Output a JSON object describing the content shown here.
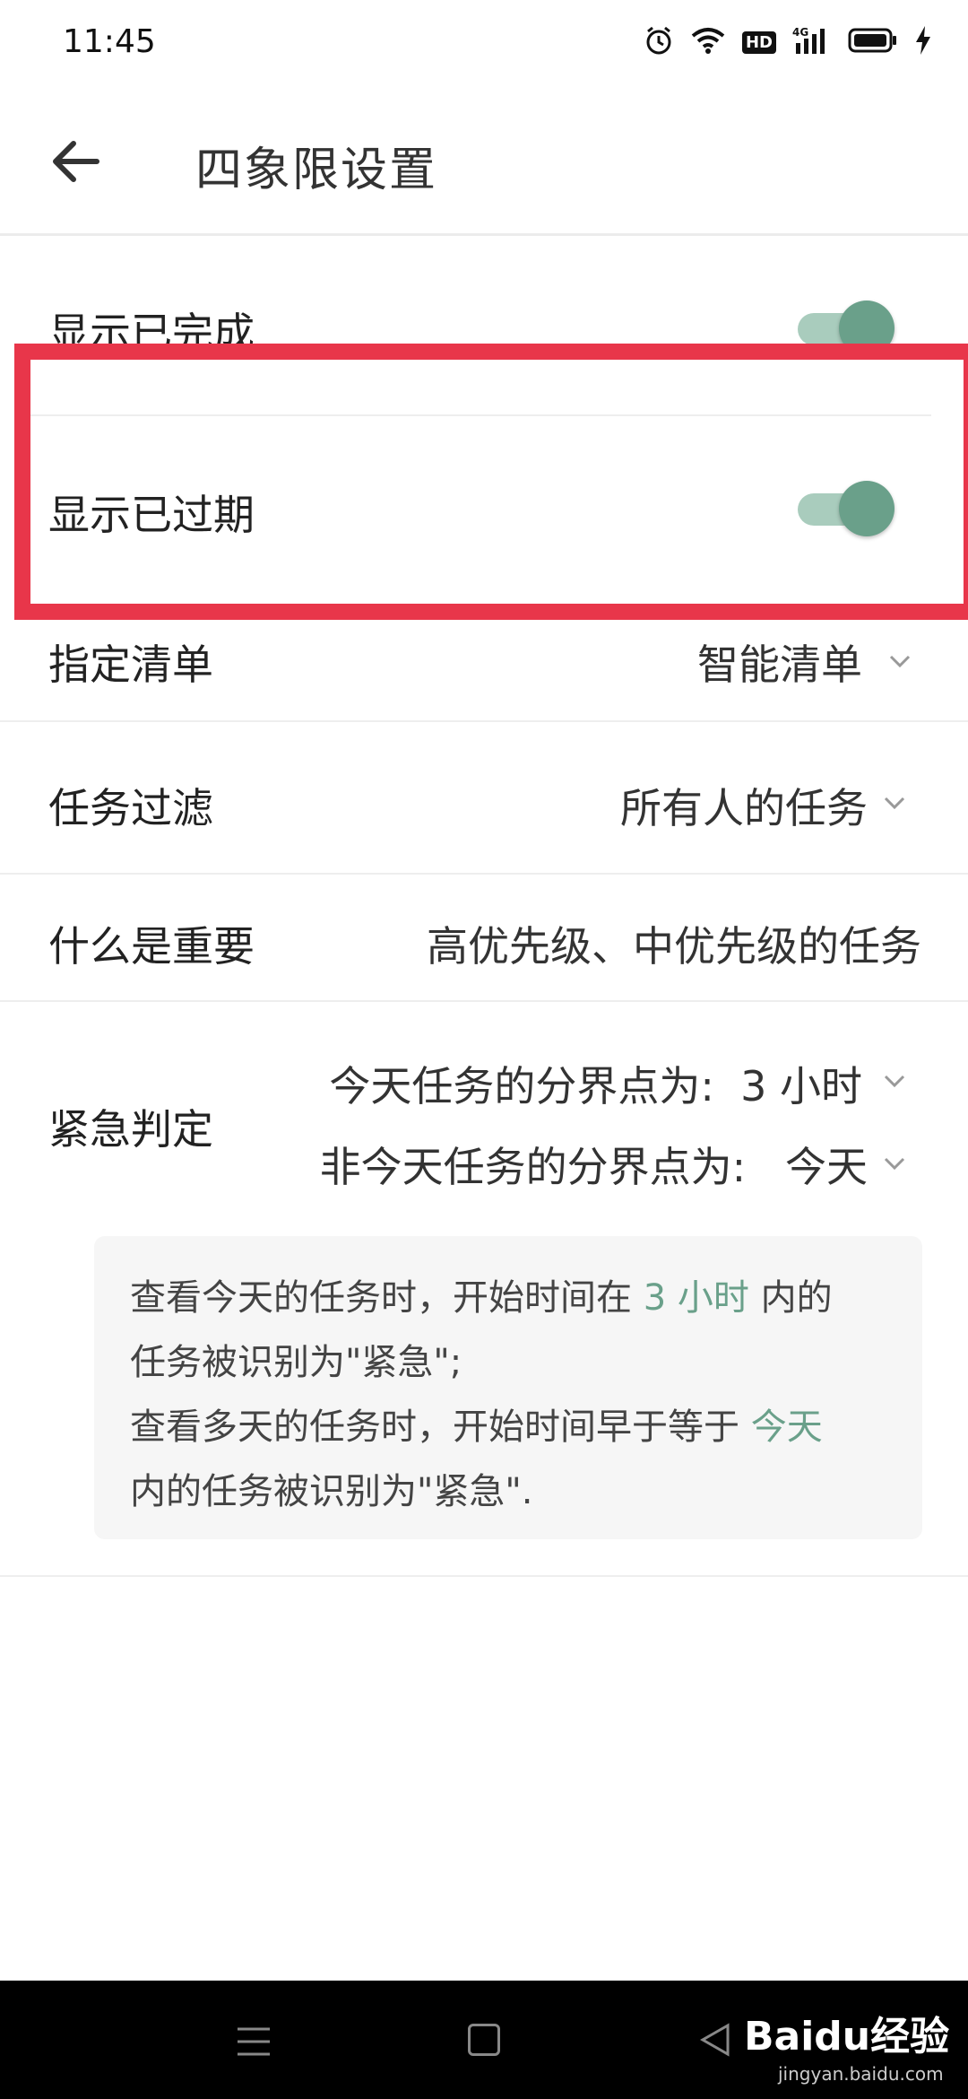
{
  "status_bar": {
    "time": "11:45",
    "icons": [
      "alarm-icon",
      "wifi-icon",
      "hd-icon",
      "signal-4g-icon",
      "battery-icon",
      "charging-icon"
    ],
    "hd_label": "HD",
    "net_label": "4G"
  },
  "app_bar": {
    "title": "四象限设置",
    "back_icon": "arrow-left-icon"
  },
  "settings": {
    "show_completed": {
      "label": "显示已完成",
      "enabled": true
    },
    "show_overdue": {
      "label": "显示已过期",
      "enabled": true
    },
    "assigned_list": {
      "label": "指定清单",
      "value": "智能清单"
    },
    "task_filter": {
      "label": "任务过滤",
      "value": "所有人的任务"
    },
    "what_is_important": {
      "label": "什么是重要",
      "value": "高优先级、中优先级的任务"
    },
    "urgency": {
      "label": "紧急判定",
      "today_cutoff": "今天任务的分界点为:  3 小时",
      "non_today_cutoff": "非今天任务的分界点为:   今天"
    }
  },
  "info": {
    "line1_prefix": "查看今天的任务时，开始时间在 ",
    "line1_accent": "3 小时",
    "line1_suffix": " 内的",
    "line2": "任务被识别为\"紧急\";",
    "line3_prefix": "查看多天的任务时，开始时间早于等于 ",
    "line3_accent": "今天",
    "line4": "内的任务被识别为\"紧急\"."
  },
  "colors": {
    "accent": "#6aa08a",
    "switch_track": "#a9ccbd",
    "highlight": "#e8364a"
  },
  "watermark": {
    "brand": "Baidu经验",
    "url": "jingyan.baidu.com"
  }
}
